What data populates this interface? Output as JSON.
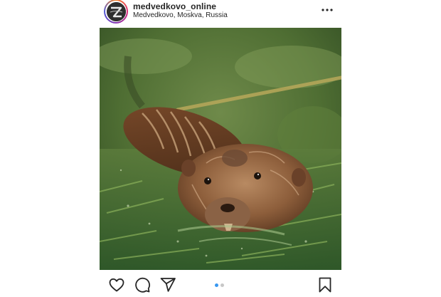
{
  "post": {
    "username": "medvedkovo_online",
    "location": "Medvedkovo, Moskva, Russia"
  },
  "icons": {
    "more": "more-options-icon",
    "like": "heart-icon",
    "comment": "comment-icon",
    "share": "share-icon",
    "save": "bookmark-icon"
  },
  "carousel": {
    "current": 1,
    "total": 2
  },
  "colors": {
    "text": "#262626",
    "active_dot": "#3897f0",
    "inactive_dot": "#c7c7c7"
  }
}
